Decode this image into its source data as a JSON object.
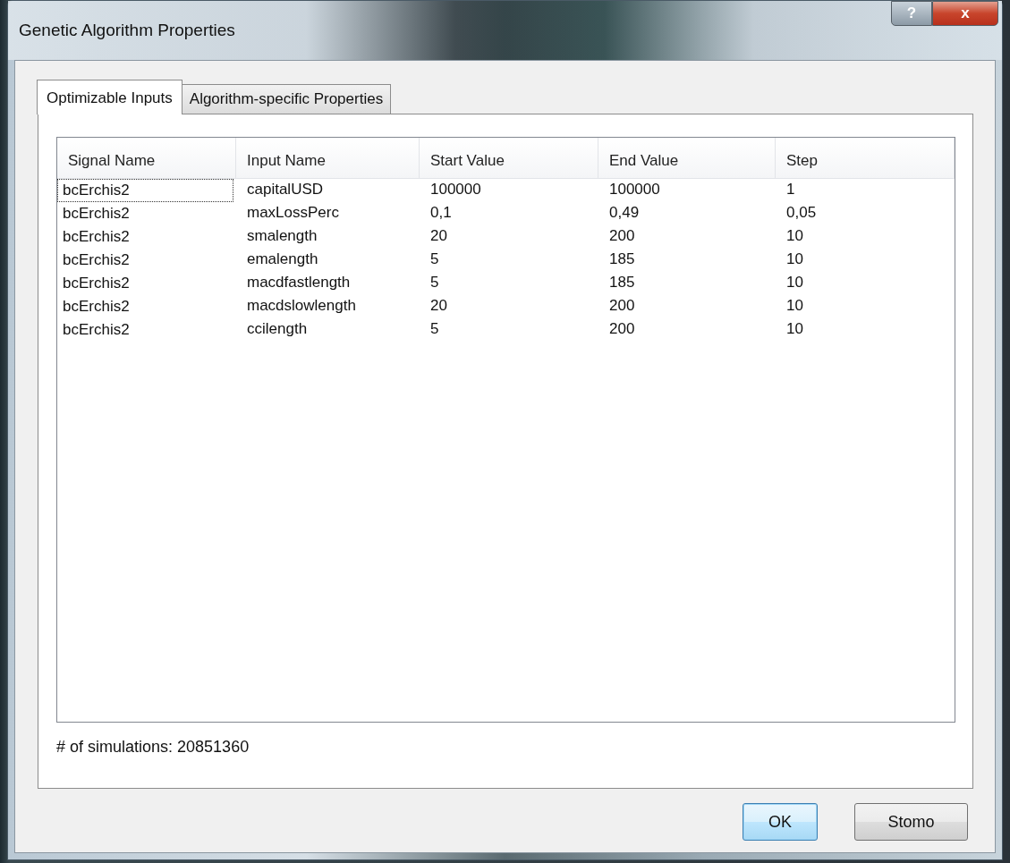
{
  "window": {
    "title": "Genetic Algorithm Properties"
  },
  "caption_buttons": [
    {
      "kind": "help",
      "label": "?"
    },
    {
      "kind": "close",
      "label": "x"
    }
  ],
  "tabs": [
    {
      "label": "Optimizable Inputs",
      "selected": true
    },
    {
      "label": "Algorithm-specific Properties",
      "selected": false
    }
  ],
  "table": {
    "columns": [
      "Signal Name",
      "Input Name",
      "Start Value",
      "End Value",
      "Step"
    ],
    "rows": [
      {
        "cells": [
          "bcErchis2",
          "capitalUSD",
          "100000",
          "100000",
          "1"
        ],
        "focused": true
      },
      {
        "cells": [
          "bcErchis2",
          "maxLossPerc",
          "0,1",
          "0,49",
          "0,05"
        ],
        "focused": false
      },
      {
        "cells": [
          "bcErchis2",
          "smalength",
          "20",
          "200",
          "10"
        ],
        "focused": false
      },
      {
        "cells": [
          "bcErchis2",
          "emalength",
          "5",
          "185",
          "10"
        ],
        "focused": false
      },
      {
        "cells": [
          "bcErchis2",
          "macdfastlength",
          "5",
          "185",
          "10"
        ],
        "focused": false
      },
      {
        "cells": [
          "bcErchis2",
          "macdslowlength",
          "20",
          "200",
          "10"
        ],
        "focused": false
      },
      {
        "cells": [
          "bcErchis2",
          "ccilength",
          "5",
          "200",
          "10"
        ],
        "focused": false
      }
    ]
  },
  "simulations": "# of simulations: 20851360",
  "buttons": [
    {
      "label": "OK",
      "default": true
    },
    {
      "label": "Stomo",
      "default": false
    }
  ]
}
